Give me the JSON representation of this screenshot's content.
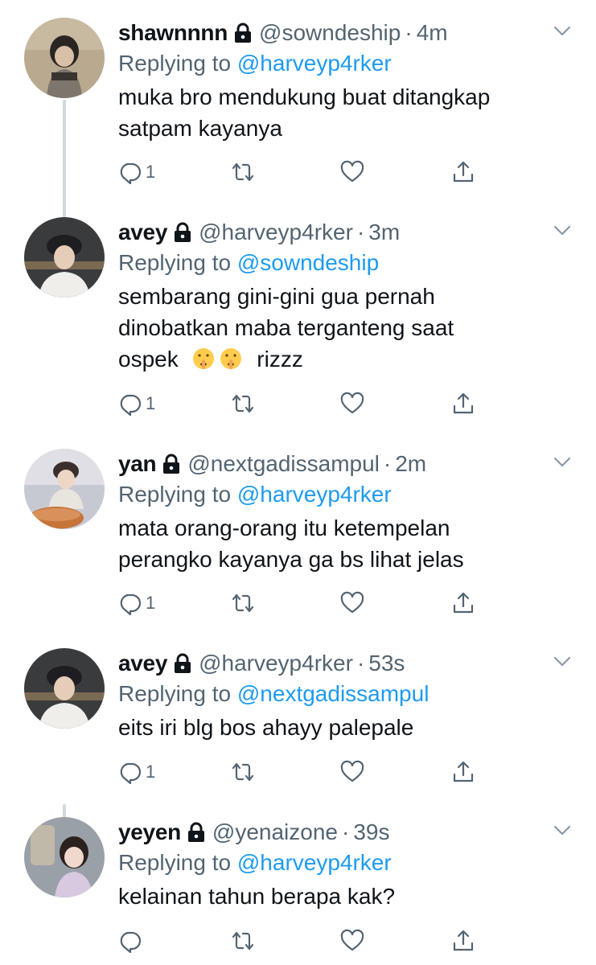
{
  "tweets": [
    {
      "display_name": "shawnnnn",
      "handle": "@sowndeship",
      "separator": "·",
      "time": "4m",
      "replying_prefix": "Replying to ",
      "replying_to": "@harveyp4rker",
      "text_lines": [
        "muka bro mendukung buat ditangkap",
        "satpam kayanya"
      ],
      "reply_count": "1",
      "avatar": {
        "bg": "#b9a98f",
        "skin": "#d9c0a8",
        "hair": "#2a2522",
        "top": "#7d766c"
      }
    },
    {
      "display_name": "avey",
      "handle": "@harveyp4rker",
      "separator": "·",
      "time": "3m",
      "replying_prefix": "Replying to ",
      "replying_to": "@sowndeship",
      "text_lines": [
        "sembarang gini-gini gua pernah",
        "dinobatkan maba terganteng saat",
        "ospek",
        "rizzz"
      ],
      "reply_count": "1",
      "avatar": {
        "bg": "#3a3b3d",
        "skin": "#e6cdb9",
        "hair": "#1e1e22",
        "top": "#efeeea"
      }
    },
    {
      "display_name": "yan",
      "handle": "@nextgadissampul",
      "separator": "·",
      "time": "2m",
      "replying_prefix": "Replying to ",
      "replying_to": "@harveyp4rker",
      "text_lines": [
        "mata orang-orang itu ketempelan",
        "perangko kayanya ga bs lihat jelas"
      ],
      "reply_count": "1",
      "avatar": {
        "bg": "#c7c9d2",
        "skin": "#edd6c6",
        "hair": "#3a2f2c",
        "top": "#e8e4de",
        "food": "#c7743a"
      }
    },
    {
      "display_name": "avey",
      "handle": "@harveyp4rker",
      "separator": "·",
      "time": "53s",
      "replying_prefix": "Replying to ",
      "replying_to": "@nextgadissampul",
      "text_lines": [
        "eits iri blg bos ahayy palepale"
      ],
      "reply_count": "1",
      "avatar": {
        "bg": "#3a3b3d",
        "skin": "#e6cdb9",
        "hair": "#1e1e22",
        "top": "#efeeea"
      }
    },
    {
      "display_name": "yeyen",
      "handle": "@yenaizone",
      "separator": "·",
      "time": "39s",
      "replying_prefix": "Replying to ",
      "replying_to": "@harveyp4rker",
      "text_lines": [
        "kelainan tahun berapa kak?"
      ],
      "reply_count": "",
      "avatar": {
        "bg": "#9aa0a8",
        "skin": "#f0d9cc",
        "hair": "#2b2220",
        "top": "#d8c8e0"
      }
    }
  ],
  "icons": {
    "lock": "lock-icon",
    "chevron": "chevron-down-icon",
    "reply": "reply-icon",
    "retweet": "retweet-icon",
    "like": "heart-icon",
    "share": "share-icon",
    "emoji": "shushing-face-emoji"
  },
  "colors": {
    "name": "#0f1419",
    "secondary": "#536471",
    "link": "#1d9bf0",
    "thread_line": "#cfd9de",
    "icon": "#536471"
  }
}
